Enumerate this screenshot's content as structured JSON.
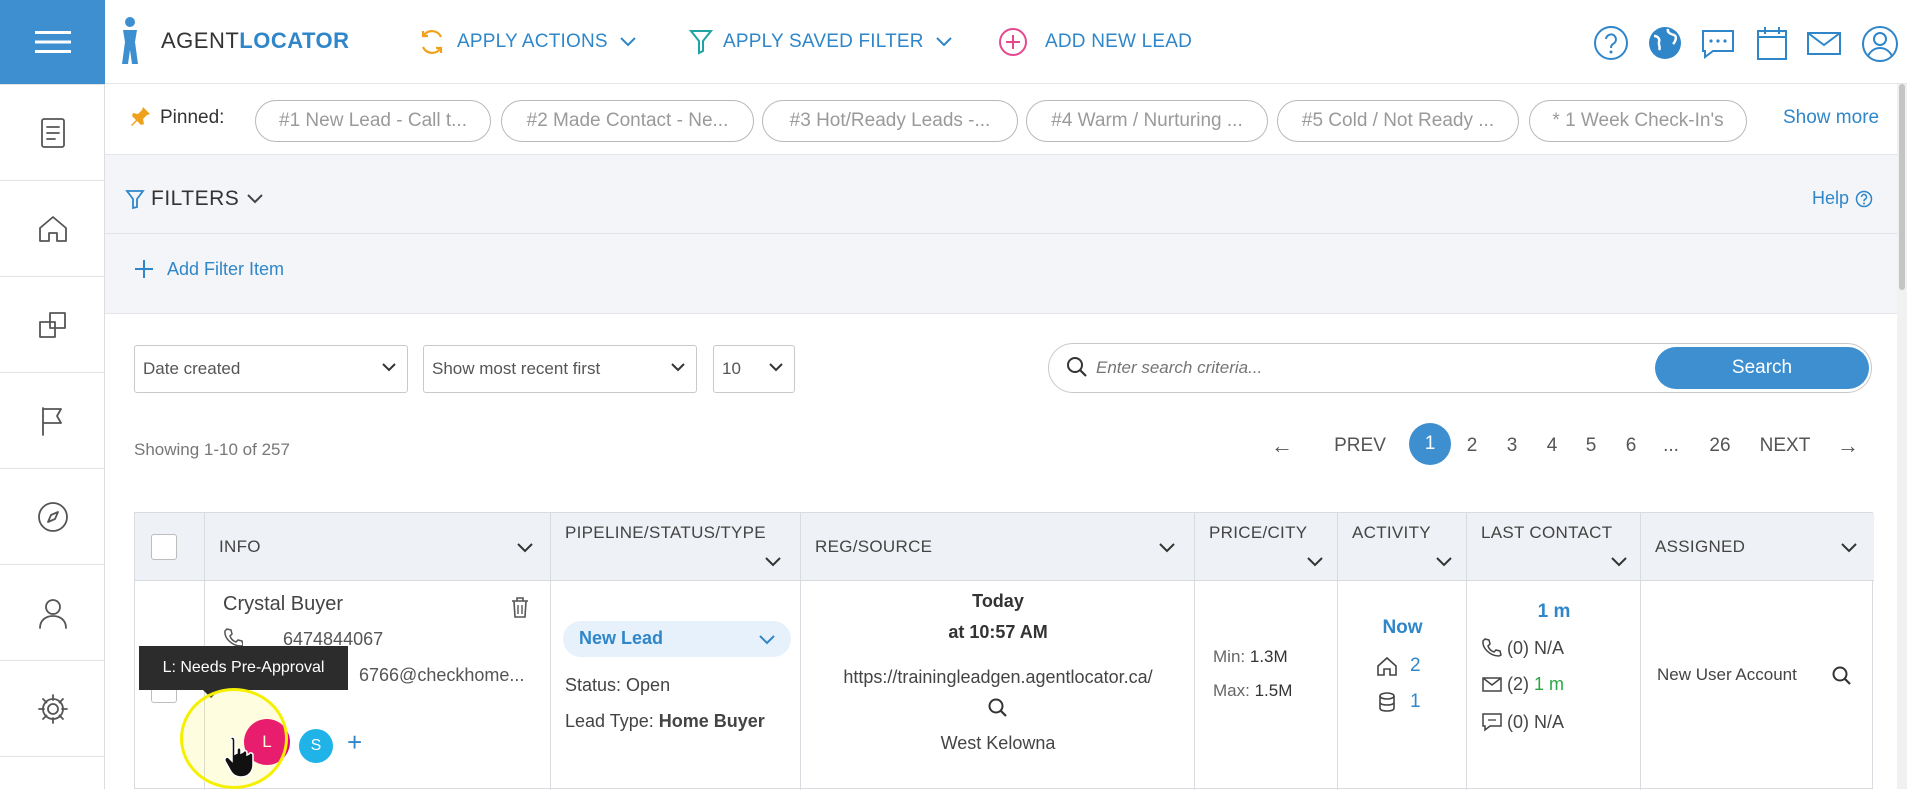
{
  "header": {
    "logo_agent": "AGENT",
    "logo_locator": "LOCATOR",
    "apply_actions": "APPLY ACTIONS",
    "apply_saved_filter": "APPLY SAVED FILTER",
    "add_new_lead": "ADD NEW LEAD"
  },
  "pinned": {
    "label": "Pinned:",
    "items": [
      "#1 New Lead - Call t...",
      "#2 Made Contact - Ne...",
      "#3 Hot/Ready Leads -...",
      "#4 Warm / Nurturing ...",
      "#5 Cold / Not Ready ...",
      "* 1 Week Check-In's"
    ],
    "show_more": "Show more"
  },
  "filters": {
    "title": "FILTERS",
    "help": "Help",
    "add_item": "Add Filter Item"
  },
  "controls": {
    "sort_field": "Date created",
    "sort_order": "Show most recent first",
    "page_size": "10",
    "search_placeholder": "Enter search criteria...",
    "search_button": "Search",
    "showing": "Showing 1-10 of 257"
  },
  "pagination": {
    "prev_arrow": "←",
    "prev": "PREV",
    "pages": [
      "1",
      "2",
      "3",
      "4",
      "5",
      "6",
      "...",
      "26"
    ],
    "next": "NEXT",
    "next_arrow": "→",
    "current": "1"
  },
  "table": {
    "headers": {
      "info": "INFO",
      "pipeline": "PIPELINE/STATUS/TYPE",
      "reg": "REG/SOURCE",
      "price": "PRICE/CITY",
      "activity": "ACTIVITY",
      "last_contact": "LAST CONTACT",
      "assigned": "ASSIGNED"
    },
    "row": {
      "name": "Crystal Buyer",
      "phone": "6474844067",
      "email": "6766@checkhome...",
      "tag_l": "L",
      "tag_s": "S",
      "tag_add": "+",
      "pipeline": "New Lead",
      "status_label": "Status:",
      "status_value": "Open",
      "type_label": "Lead Type:",
      "type_value": "Home Buyer",
      "reg_day": "Today",
      "reg_time": "at 10:57 AM",
      "source_url": "https://trainingleadgen.agentlocator.ca/",
      "city": "West Kelowna",
      "min_label": "Min:",
      "min_value": "1.3M",
      "max_label": "Max:",
      "max_value": "1.5M",
      "activity_time": "Now",
      "activity_homes": "2",
      "activity_db": "1",
      "last_time": "1 m",
      "calls": "(0) N/A",
      "emails_count": "(2)",
      "emails_time": "1 m",
      "texts": "(0) N/A",
      "assigned": "New User Account"
    },
    "tooltip": "L: Needs Pre-Approval"
  },
  "colors": {
    "primary": "#3d8fd0",
    "tag_l": "#e6007e",
    "tag_s": "#1fb3e8",
    "green": "#29a745",
    "highlight": "#f5f000"
  }
}
